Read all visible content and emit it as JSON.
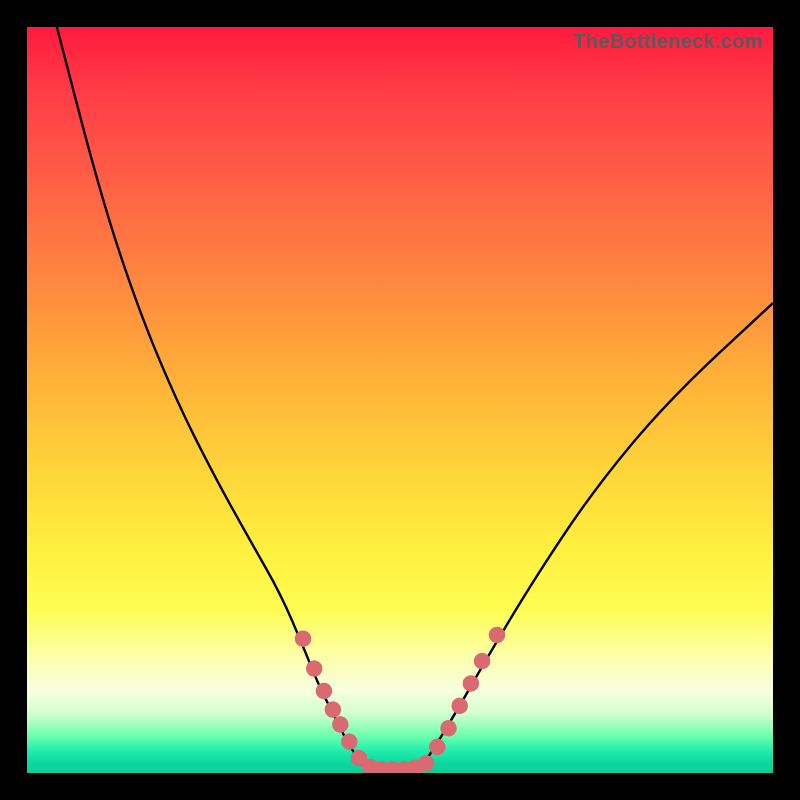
{
  "watermark": "TheBottleneck.com",
  "colors": {
    "frame": "#000000",
    "curve_stroke": "#000000",
    "marker_fill": "#d96a72",
    "marker_stroke": "#d96a72"
  },
  "chart_data": {
    "type": "line",
    "title": "",
    "xlabel": "",
    "ylabel": "",
    "xlim": [
      0,
      100
    ],
    "ylim": [
      0,
      100
    ],
    "grid": false,
    "curves": [
      {
        "name": "left-branch",
        "x": [
          4,
          10,
          15,
          20,
          25,
          30,
          34,
          37,
          39,
          41,
          43,
          45
        ],
        "y": [
          100,
          77,
          62,
          50,
          40,
          31,
          24,
          17,
          12,
          8,
          4,
          1
        ]
      },
      {
        "name": "valley-floor",
        "x": [
          45,
          47,
          49,
          51,
          53
        ],
        "y": [
          1,
          0.5,
          0.5,
          0.5,
          1
        ]
      },
      {
        "name": "right-branch",
        "x": [
          53,
          55,
          58,
          62,
          68,
          76,
          86,
          100
        ],
        "y": [
          1,
          4,
          9,
          16,
          26,
          38,
          50,
          63
        ]
      }
    ],
    "markers": [
      {
        "x": 37.0,
        "y": 18.0
      },
      {
        "x": 38.5,
        "y": 14.0
      },
      {
        "x": 39.8,
        "y": 11.0
      },
      {
        "x": 41.0,
        "y": 8.5
      },
      {
        "x": 42.0,
        "y": 6.5
      },
      {
        "x": 43.2,
        "y": 4.2
      },
      {
        "x": 44.5,
        "y": 2.0
      },
      {
        "x": 46.0,
        "y": 0.8
      },
      {
        "x": 47.5,
        "y": 0.5
      },
      {
        "x": 49.0,
        "y": 0.5
      },
      {
        "x": 50.5,
        "y": 0.5
      },
      {
        "x": 52.0,
        "y": 0.7
      },
      {
        "x": 53.5,
        "y": 1.3
      },
      {
        "x": 55.0,
        "y": 3.5
      },
      {
        "x": 56.5,
        "y": 6.0
      },
      {
        "x": 58.0,
        "y": 9.0
      },
      {
        "x": 59.5,
        "y": 12.0
      },
      {
        "x": 61.0,
        "y": 15.0
      },
      {
        "x": 63.0,
        "y": 18.5
      }
    ],
    "marker_radius_pct": 1.1
  }
}
